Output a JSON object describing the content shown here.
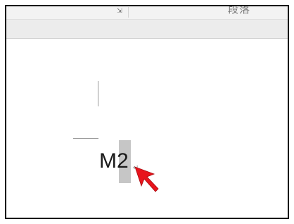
{
  "ribbon": {
    "group_label": "段落",
    "launcher_icon": "dialog-launcher-icon"
  },
  "document": {
    "text": "M2",
    "paragraph_mark": "↵",
    "selection_color": "#c6c6c6"
  },
  "pointer": {
    "icon": "red-arrow-cursor-icon",
    "color": "#e8141c"
  }
}
